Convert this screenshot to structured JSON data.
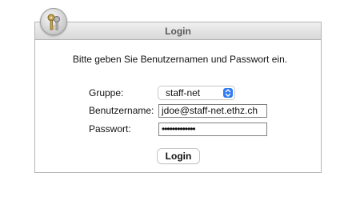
{
  "dialog": {
    "title": "Login",
    "prompt": "Bitte geben Sie Benutzernamen und Passwort ein."
  },
  "form": {
    "group_label": "Gruppe:",
    "group_value": "staff-net",
    "username_label": "Benutzername:",
    "username_value": "jdoe@staff-net.ethz.ch",
    "password_label": "Passwort:",
    "password_value": "•••••••••••••",
    "submit_label": "Login"
  },
  "icons": {
    "logo": "keys-icon",
    "select_arrows": "select-arrows-icon"
  },
  "colors": {
    "accent": "#2f7bf5",
    "title_text": "#5a5a5a"
  }
}
